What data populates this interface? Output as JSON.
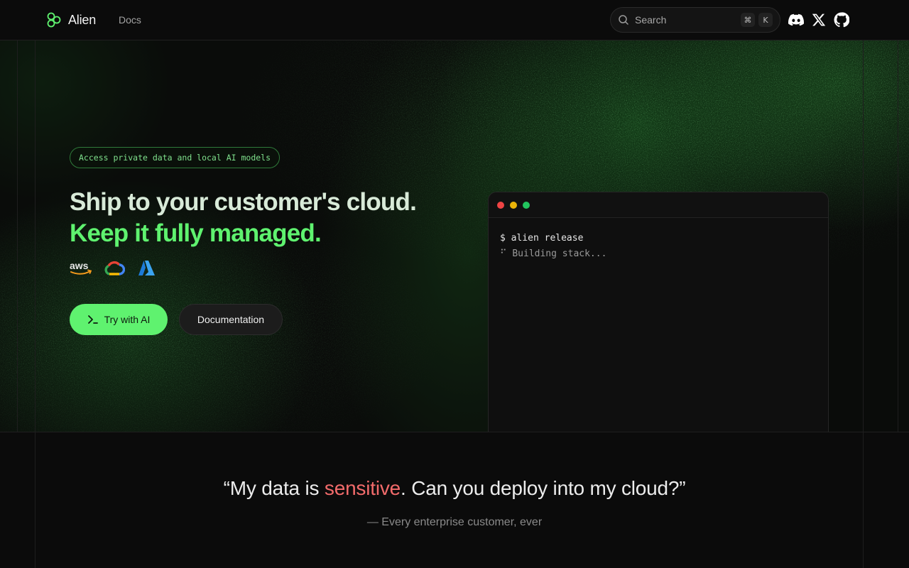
{
  "nav": {
    "brand": "Alien",
    "links": [
      "Docs"
    ],
    "search_placeholder": "Search",
    "shortcut_keys": [
      "⌘",
      "K"
    ],
    "social_icons": [
      "discord-icon",
      "x-icon",
      "github-icon"
    ]
  },
  "hero": {
    "badge": "Access private data and local AI models",
    "headline_line1": "Ship to your customer's cloud.",
    "headline_line2": "Keep it fully managed.",
    "cloud_logos": [
      "aws-logo",
      "google-cloud-logo",
      "azure-logo"
    ],
    "primary_button": "Try with AI",
    "secondary_button": "Documentation",
    "terminal": {
      "command": "$ alien release",
      "output": "⠋ Building stack..."
    }
  },
  "quote": {
    "before": "“My data is ",
    "highlight": "sensitive",
    "after": ". Can you deploy into my cloud?”",
    "attribution": "— Every enterprise customer, ever"
  },
  "colors": {
    "accent": "#5ff26f",
    "highlight": "#f26b6b",
    "background": "#0b0b0b"
  }
}
